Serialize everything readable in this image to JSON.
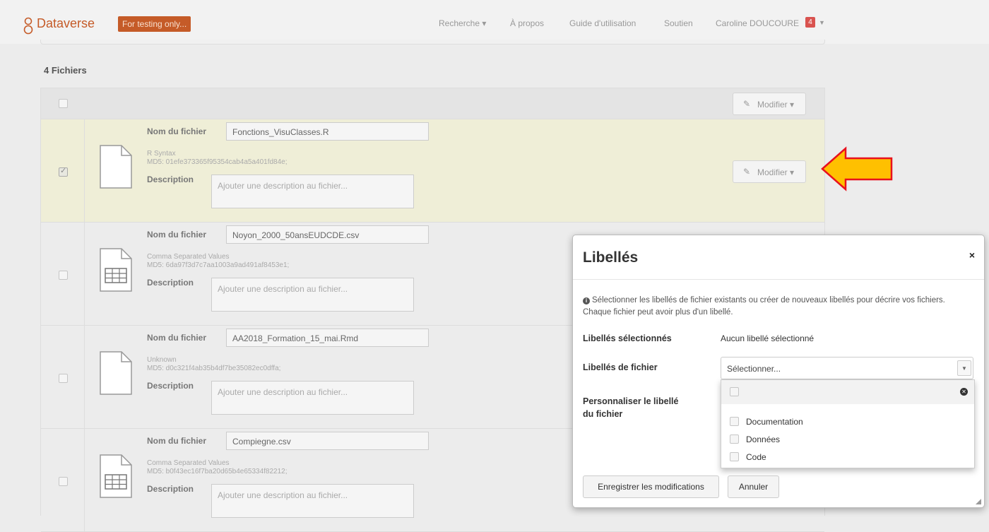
{
  "navbar": {
    "brand": "Dataverse",
    "test_badge": "For testing only...",
    "items": [
      "Recherche ▾",
      "À propos",
      "Guide d'utilisation",
      "Soutien",
      "Caroline DOUCOURE"
    ],
    "notif_count": "4"
  },
  "files": {
    "count_label": "4 Fichiers",
    "modify_label": "Modifier ▾",
    "name_label": "Nom du fichier",
    "desc_label": "Description",
    "desc_placeholder": "Ajouter une description au fichier...",
    "rows": [
      {
        "name": "Fonctions_VisuClasses.R",
        "type": "R Syntax",
        "md5": "MD5: 01efe373365f95354cab4a5a401fd84e;",
        "checked": true,
        "icon": "file-icon"
      },
      {
        "name": "Noyon_2000_50ansEUDCDE.csv",
        "type": "Comma Separated Values",
        "md5": "MD5: 6da97f3d7c7aa1003a9ad491af8453e1;",
        "checked": false,
        "icon": "table-file-icon"
      },
      {
        "name": "AA2018_Formation_15_mai.Rmd",
        "type": "Unknown",
        "md5": "MD5: d0c321f4ab35b4df7be35082ec0dffa;",
        "checked": false,
        "icon": "file-icon"
      },
      {
        "name": "Compiegne.csv",
        "type": "Comma Separated Values",
        "md5": "MD5: b0f43ec16f7ba20d65b4e65334f82212;",
        "checked": false,
        "icon": "table-file-icon"
      }
    ]
  },
  "modal": {
    "title": "Libellés",
    "close": "×",
    "info": "Sélectionner les libellés de fichier existants ou créer de nouveaux libellés pour décrire vos fichiers. Chaque fichier peut avoir plus d'un libellé.",
    "selected_label": "Libellés sélectionnés",
    "selected_value": "Aucun libellé sélectionné",
    "file_tags_label": "Libellés de fichier",
    "select_placeholder": "Sélectionner...",
    "custom_label_line1": "Personnaliser le libellé",
    "custom_label_line2": "du fichier",
    "options": [
      "Documentation",
      "Données",
      "Code"
    ],
    "save_button": "Enregistrer les modifications",
    "cancel_button": "Annuler"
  },
  "colors": {
    "brand": "#c55b28",
    "selected_row": "#efeed7",
    "arrow_fill": "#ffc000",
    "arrow_stroke": "#e8111d"
  }
}
